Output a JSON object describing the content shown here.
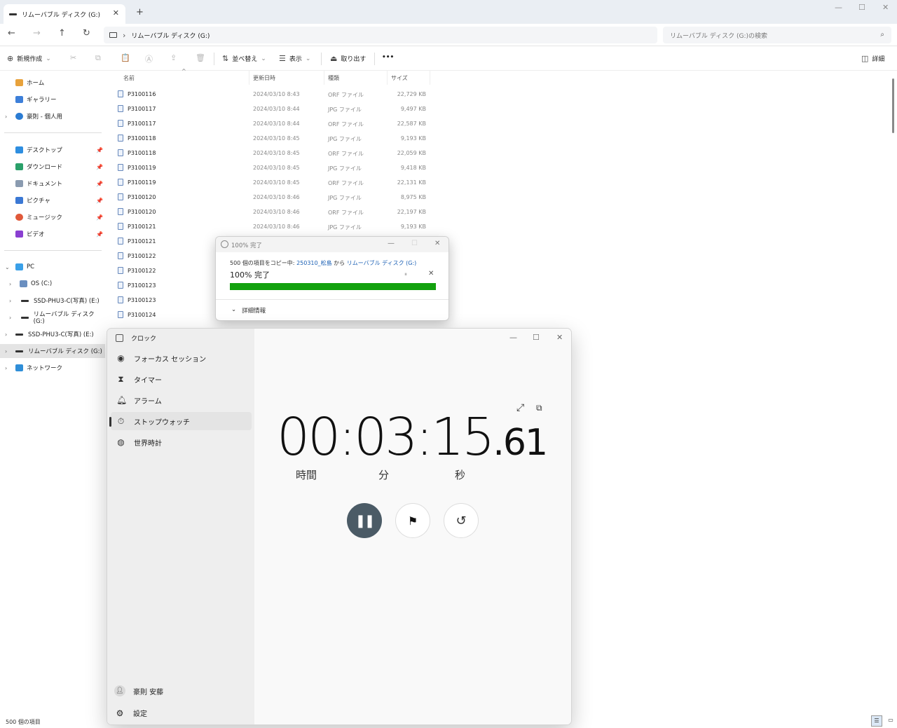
{
  "explorer": {
    "tab_title": "リムーバブル ディスク (G:)",
    "tab_close": "✕",
    "new_tab": "+",
    "window_controls": {
      "minimize": "—",
      "maximize": "☐",
      "close": "✕"
    },
    "address": "リムーバブル ディスク (G:)",
    "address_separator": "›",
    "search_placeholder": "リムーバブル ディスク (G:)の検索",
    "toolbar": {
      "new": "新規作成",
      "sort": "並べ替え",
      "view": "表示",
      "eject": "取り出す",
      "more": "•••",
      "details": "詳細"
    },
    "sidebar": {
      "home": "ホーム",
      "gallery": "ギャラリー",
      "onedrive": "豪則 - 個人用",
      "desktop": "デスクトップ",
      "downloads": "ダウンロード",
      "documents": "ドキュメント",
      "pictures": "ピクチャ",
      "music": "ミュージック",
      "videos": "ビデオ",
      "pc": "PC",
      "os": "OS (C:)",
      "ssd_sub": "SSD-PHU3-C(写真) (E:)",
      "removable_sub": "リムーバブル ディスク (G:)",
      "ssd": "SSD-PHU3-C(写真) (E:)",
      "removable": "リムーバブル ディスク (G:)",
      "network": "ネットワーク"
    },
    "columns": {
      "name": "名前",
      "modified": "更新日時",
      "type": "種類",
      "size": "サイズ"
    },
    "files": [
      {
        "name": "P3100116",
        "date": "2024/03/10 8:43",
        "type": "ORF ファイル",
        "size": "22,729 KB"
      },
      {
        "name": "P3100117",
        "date": "2024/03/10 8:44",
        "type": "JPG ファイル",
        "size": "9,497 KB"
      },
      {
        "name": "P3100117",
        "date": "2024/03/10 8:44",
        "type": "ORF ファイル",
        "size": "22,587 KB"
      },
      {
        "name": "P3100118",
        "date": "2024/03/10 8:45",
        "type": "JPG ファイル",
        "size": "9,193 KB"
      },
      {
        "name": "P3100118",
        "date": "2024/03/10 8:45",
        "type": "ORF ファイル",
        "size": "22,059 KB"
      },
      {
        "name": "P3100119",
        "date": "2024/03/10 8:45",
        "type": "JPG ファイル",
        "size": "9,418 KB"
      },
      {
        "name": "P3100119",
        "date": "2024/03/10 8:45",
        "type": "ORF ファイル",
        "size": "22,131 KB"
      },
      {
        "name": "P3100120",
        "date": "2024/03/10 8:46",
        "type": "JPG ファイル",
        "size": "8,975 KB"
      },
      {
        "name": "P3100120",
        "date": "2024/03/10 8:46",
        "type": "ORF ファイル",
        "size": "22,197 KB"
      },
      {
        "name": "P3100121",
        "date": "2024/03/10 8:46",
        "type": "JPG ファイル",
        "size": "9,193 KB"
      },
      {
        "name": "P3100121",
        "date": "",
        "type": "",
        "size": ""
      },
      {
        "name": "P3100122",
        "date": "",
        "type": "",
        "size": ""
      },
      {
        "name": "P3100122",
        "date": "",
        "type": "",
        "size": ""
      },
      {
        "name": "P3100123",
        "date": "",
        "type": "",
        "size": ""
      },
      {
        "name": "P3100123",
        "date": "",
        "type": "",
        "size": ""
      },
      {
        "name": "P3100124",
        "date": "",
        "type": "",
        "size": ""
      }
    ],
    "status": "500 個の項目"
  },
  "copy_dialog": {
    "title": "100% 完了",
    "message_prefix": "500 個の項目をコピー中: ",
    "source": "250310_松島",
    "message_mid": " から ",
    "destination": "リムーバブル ディスク (G:)",
    "percent_label": "100% 完了",
    "progress": 1.0,
    "pause": "⏸",
    "cancel": "✕",
    "details": "詳細情報"
  },
  "clock_app": {
    "title": "クロック",
    "nav": {
      "focus": "フォーカス セッション",
      "timer": "タイマー",
      "alarm": "アラーム",
      "stopwatch": "ストップウォッチ",
      "world": "世界時計"
    },
    "stopwatch": {
      "hours": "00",
      "minutes": "03",
      "seconds": "15",
      "hundredths": ".61",
      "label_hours": "時間",
      "label_minutes": "分",
      "label_seconds": "秒"
    },
    "user": "豪則 安藤",
    "settings": "設定"
  },
  "colors": {
    "progress": "#13a10e",
    "pause_button": "#4b5b66",
    "link": "#1a5fb4"
  }
}
